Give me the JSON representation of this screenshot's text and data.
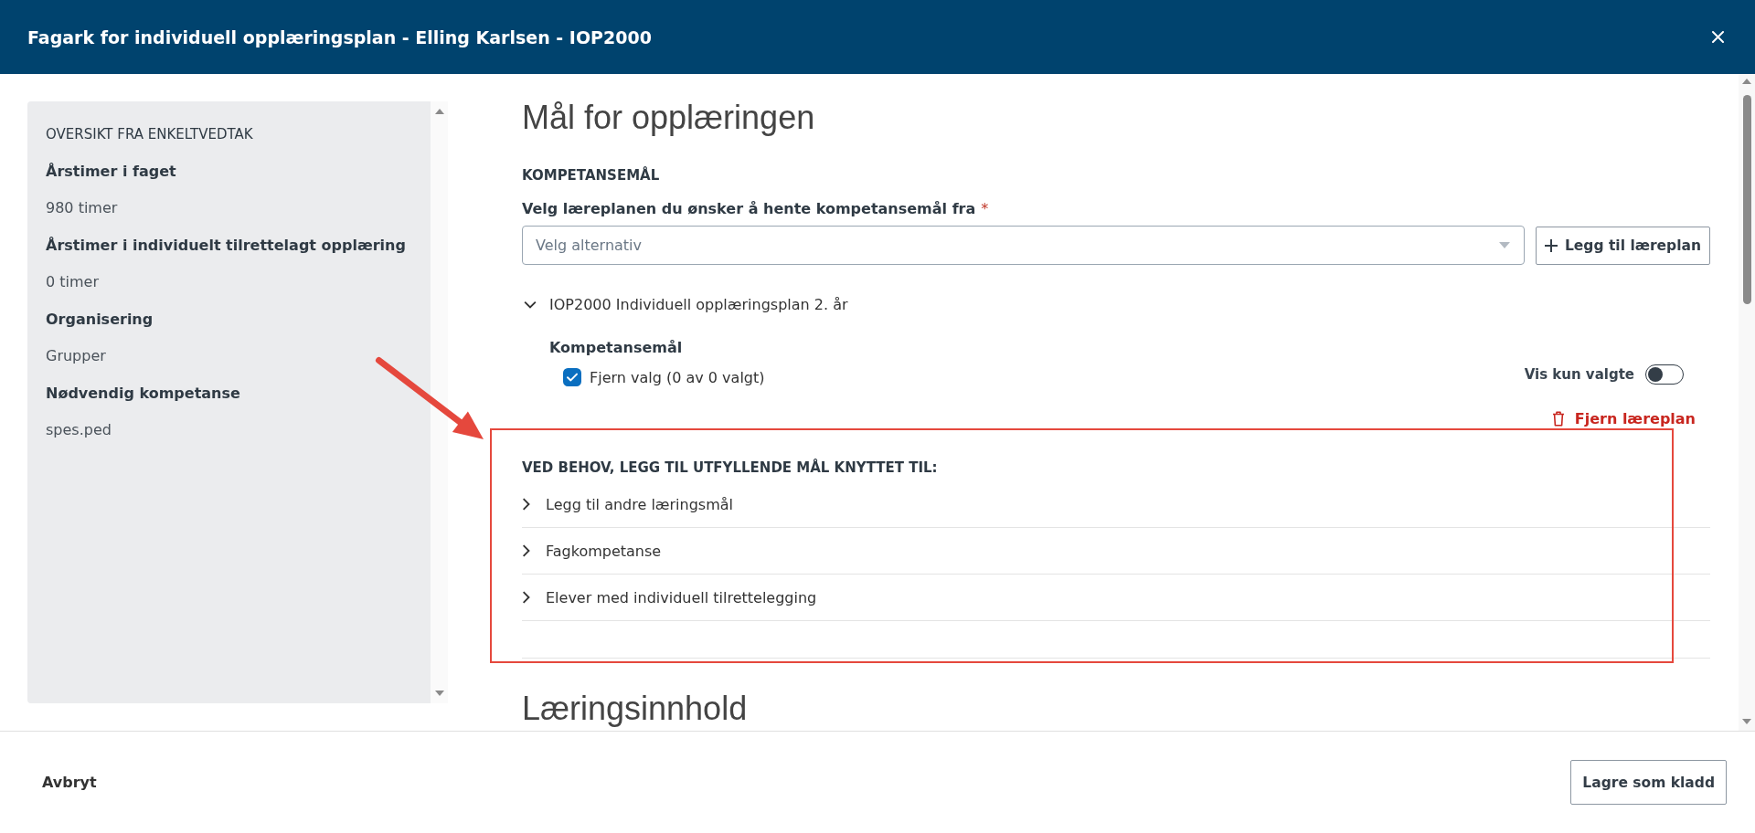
{
  "window": {
    "title": "Fagark for individuell opplæringsplan - Elling Karlsen - IOP2000"
  },
  "sidebar": {
    "heading": "OVERSIKT FRA ENKELTVEDTAK",
    "fields": [
      {
        "label": "Årstimer i faget",
        "value": "980 timer"
      },
      {
        "label": "Årstimer i individuelt tilrettelagt opplæring",
        "value": "0 timer"
      },
      {
        "label": "Organisering",
        "value": "Grupper"
      },
      {
        "label": "Nødvendig kompetanse",
        "value": "spes.ped"
      }
    ]
  },
  "main": {
    "title": "Mål for opplæringen",
    "competence": {
      "heading": "KOMPETANSEMÅL",
      "select_label": "Velg læreplanen du ønsker å hente kompetansemål fra",
      "required_mark": "*",
      "select": {
        "placeholder": "Velg alternativ"
      },
      "add_button": "Legg til læreplan",
      "curricula": [
        {
          "title": "IOP2000 Individuell opplæringsplan 2. år",
          "expanded": true,
          "subheading": "Kompetansemål",
          "select_all": {
            "label": "Fjern valg (0 av 0 valgt)",
            "checked": true
          },
          "filter_toggle": {
            "label": "Vis kun valgte",
            "on": false
          },
          "remove_button": "Fjern læreplan"
        }
      ]
    },
    "additional": {
      "heading": "VED BEHOV, LEGG TIL UTFYLLENDE MÅL KNYTTET TIL:",
      "items": [
        {
          "label": "Legg til andre læringsmål",
          "expanded": false
        },
        {
          "label": "Fagkompetanse",
          "expanded": false
        },
        {
          "label": "Elever med individuell tilrettelegging",
          "expanded": false
        }
      ]
    },
    "next_section": {
      "title": "Læringsinnhold"
    }
  },
  "footer": {
    "cancel_button": "Avbryt",
    "save_button": "Lagre som kladd"
  }
}
